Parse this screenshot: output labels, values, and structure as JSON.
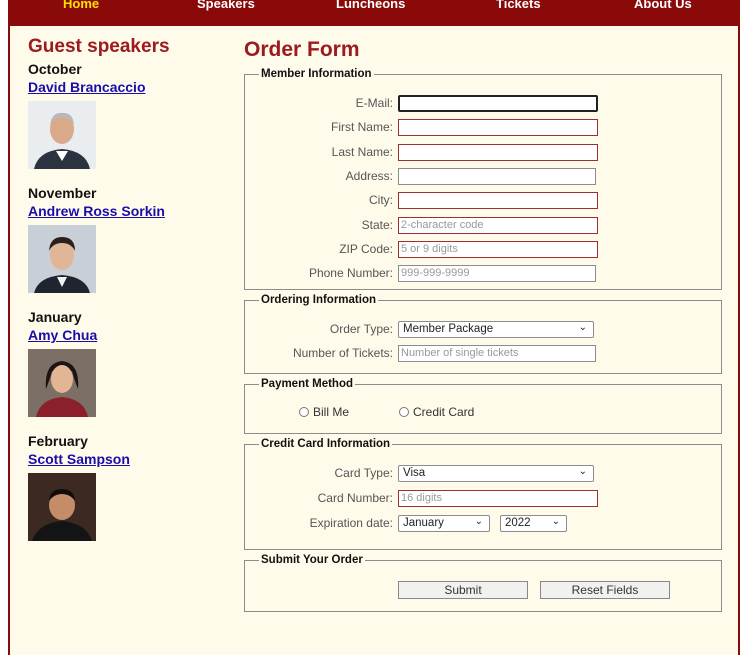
{
  "nav": {
    "items": [
      {
        "label": "Home",
        "active": true
      },
      {
        "label": "Speakers"
      },
      {
        "label": "Luncheons"
      },
      {
        "label": "Tickets"
      },
      {
        "label": "About Us"
      }
    ]
  },
  "sidebar": {
    "title": "Guest speakers",
    "speakers": [
      {
        "month": "October",
        "name": "David Brancaccio"
      },
      {
        "month": "November",
        "name": "Andrew Ross Sorkin"
      },
      {
        "month": "January",
        "name": "Amy Chua"
      },
      {
        "month": "February",
        "name": "Scott Sampson"
      }
    ]
  },
  "form": {
    "title": "Order Form",
    "member": {
      "legend": "Member Information",
      "email_label": "E-Mail:",
      "first_label": "First Name:",
      "last_label": "Last Name:",
      "address_label": "Address:",
      "city_label": "City:",
      "state_label": "State:",
      "state_placeholder": "2-character code",
      "zip_label": "ZIP Code:",
      "zip_placeholder": "5 or 9 digits",
      "phone_label": "Phone Number:",
      "phone_placeholder": "999-999-9999"
    },
    "ordering": {
      "legend": "Ordering Information",
      "type_label": "Order Type:",
      "type_value": "Member Package",
      "tickets_label": "Number of Tickets:",
      "tickets_placeholder": "Number of single tickets"
    },
    "payment": {
      "legend": "Payment Method",
      "bill_me": "Bill Me",
      "credit_card": "Credit Card"
    },
    "card": {
      "legend": "Credit Card Information",
      "type_label": "Card Type:",
      "type_value": "Visa",
      "number_label": "Card Number:",
      "number_placeholder": "16 digits",
      "exp_label": "Expiration date:",
      "exp_month": "January",
      "exp_year": "2022"
    },
    "submit": {
      "legend": "Submit Your Order",
      "submit_label": "Submit",
      "reset_label": "Reset Fields"
    }
  },
  "colors": {
    "nav_bg": "#8a0a0a",
    "accent": "#9b1c20",
    "page_bg": "#fffbeb",
    "link": "#1a0dab",
    "nav_active": "#ffe000"
  }
}
